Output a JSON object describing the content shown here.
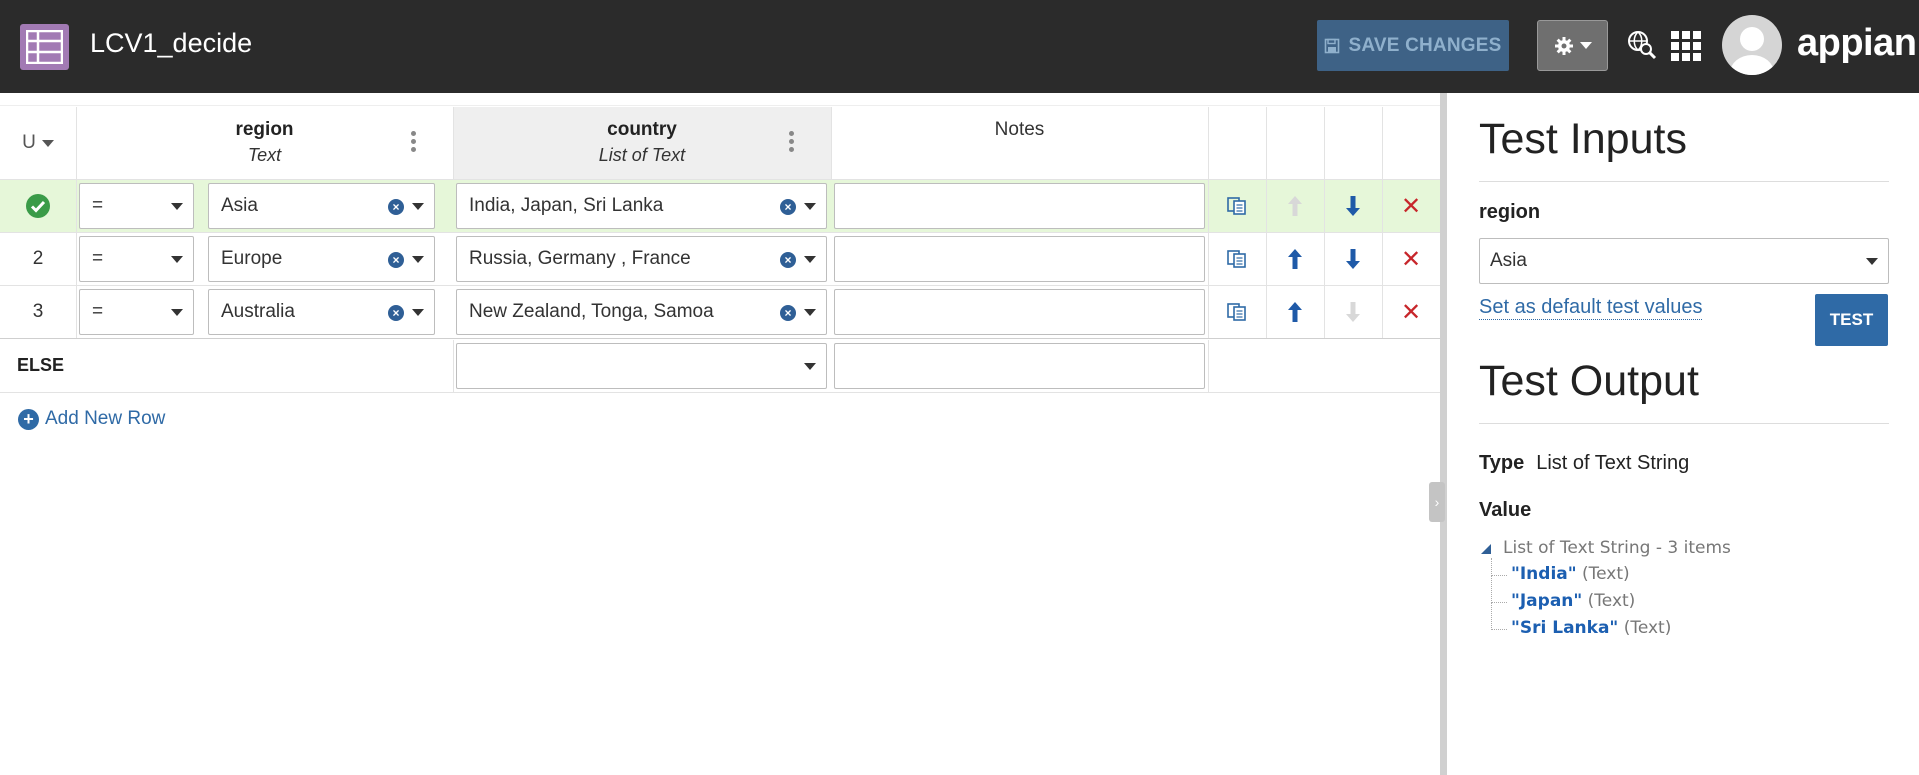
{
  "header": {
    "title": "LCV1_decide",
    "save_label": "SAVE CHANGES",
    "logo": "appian"
  },
  "table": {
    "hit_policy": "U",
    "columns": [
      {
        "title": "region",
        "subtitle": "Text"
      },
      {
        "title": "country",
        "subtitle": "List of Text"
      },
      {
        "title": "Notes"
      }
    ],
    "rows": [
      {
        "number": "",
        "operator": "=",
        "region": "Asia",
        "country": "India, Japan, Sri Lanka",
        "notes": "",
        "matched": true
      },
      {
        "number": "2",
        "operator": "=",
        "region": "Europe",
        "country": "Russia, Germany , France",
        "notes": ""
      },
      {
        "number": "3",
        "operator": "=",
        "region": "Australia",
        "country": "New Zealand, Tonga, Samoa",
        "notes": ""
      }
    ],
    "else_label": "ELSE",
    "add_row_label": "Add New Row"
  },
  "panel": {
    "test_inputs_title": "Test Inputs",
    "input_label": "region",
    "input_value": "Asia",
    "set_default_label": "Set as default test values",
    "test_button": "TEST",
    "test_output_title": "Test Output",
    "type_label": "Type",
    "type_value": "List of Text String",
    "value_label": "Value",
    "tree": {
      "root": "List of Text String - 3 items",
      "items": [
        {
          "value": "\"India\"",
          "type": "(Text)"
        },
        {
          "value": "\"Japan\"",
          "type": "(Text)"
        },
        {
          "value": "\"Sri Lanka\"",
          "type": "(Text)"
        }
      ]
    }
  },
  "colors": {
    "header_bg": "#2b2b2b",
    "accent": "#2f6aa6",
    "app_icon": "#a27ab4",
    "matched_row": "#e6f7d9",
    "delete": "#c7262b"
  }
}
